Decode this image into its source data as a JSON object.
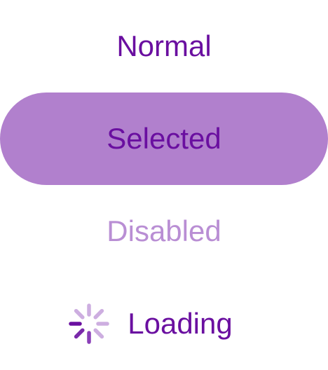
{
  "menu": {
    "items": [
      {
        "label": "Normal",
        "state": "normal"
      },
      {
        "label": "Selected",
        "state": "selected"
      },
      {
        "label": "Disabled",
        "state": "disabled"
      },
      {
        "label": "Loading",
        "state": "loading",
        "icon": "spinner-icon"
      }
    ]
  },
  "colors": {
    "text": "#6a0fa0",
    "selected_background": "#b180cd",
    "disabled_text": "#b98ed4",
    "spinner_light": "#cdaee0"
  }
}
